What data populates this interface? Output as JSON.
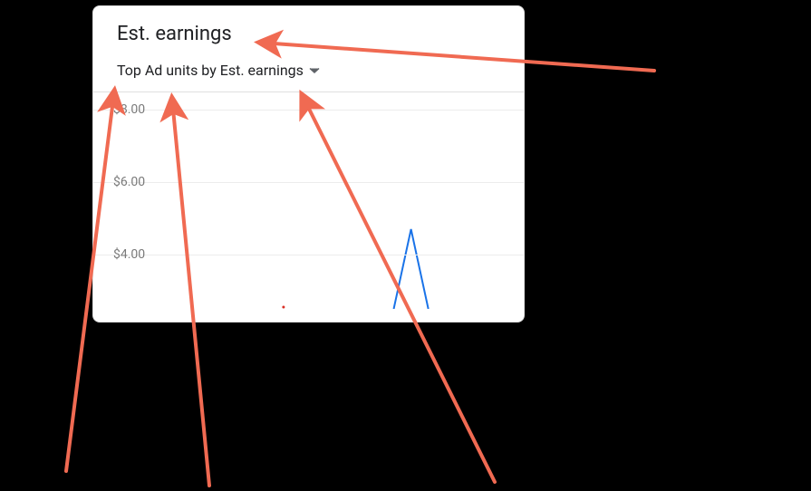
{
  "card": {
    "title": "Est. earnings",
    "subtitle": "Top Ad units by Est. earnings"
  },
  "chart_data": {
    "type": "line",
    "ylabel": "",
    "xlabel": "",
    "ylim": [
      2.5,
      8.5
    ],
    "y_ticks_visible": [
      "$8.00",
      "$6.00",
      "$4.00"
    ],
    "y_prefix": "$",
    "y_format": "0.00",
    "series": [
      {
        "name": "series-1",
        "color": "#1a73e8",
        "visible_segment": [
          {
            "x_frac": 0.695,
            "y": 2.5
          },
          {
            "x_frac": 0.735,
            "y": 4.7
          },
          {
            "x_frac": 0.775,
            "y": 2.5
          }
        ]
      },
      {
        "name": "series-2",
        "color": "#d93025",
        "visible_segment": [
          {
            "x_frac": 0.44,
            "y": 2.55
          }
        ]
      }
    ]
  },
  "annotations": {
    "arrows": [
      {
        "name": "arrow-to-title",
        "from": [
          722,
          78
        ],
        "to": [
          288,
          47
        ],
        "color": "#f06a52"
      },
      {
        "name": "arrow-to-dropdown",
        "from": [
          546,
          532
        ],
        "to": [
          334,
          106
        ],
        "color": "#f06a52"
      },
      {
        "name": "arrow-to-subtitle-text",
        "from": [
          231,
          536
        ],
        "to": [
          190,
          110
        ],
        "color": "#f06a52"
      },
      {
        "name": "arrow-to-top",
        "from": [
          73,
          520
        ],
        "to": [
          126,
          102
        ],
        "color": "#f06a52"
      }
    ]
  }
}
